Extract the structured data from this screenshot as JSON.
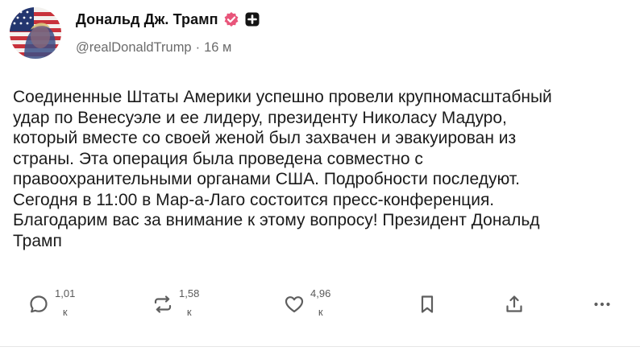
{
  "post": {
    "author": {
      "display_name": "Дональд Дж. Трамп",
      "handle": "@realDonaldTrump",
      "separator": "·",
      "time": "16 м",
      "avatar_icon": "avatar-flag-portrait",
      "verified_icon": "verified-badge-icon",
      "extra_badge_icon": "plus-badge-icon",
      "verified_color": "#e8557a"
    },
    "text_lines": [
      "Соединенные Штаты Америки успешно провели крупномасштабный",
      "удар по Венесуэле и ее лидеру, президенту Николасу Мадуро,",
      "который вместе со своей женой был захвачен и эвакуирован из",
      "страны. Эта операция была проведена совместно с",
      "правоохранительными органами США. Подробности последуют.",
      "Сегодня в 11:00 в Мар-а-Лаго состоится пресс-конференция.",
      "Благодарим вас за внимание к этому вопросу! Президент Дональд",
      "Трамп"
    ],
    "actions": {
      "reply": {
        "count": "1,01",
        "unit": "к",
        "icon": "reply-icon"
      },
      "repost": {
        "count": "1,58",
        "unit": "к",
        "icon": "repost-icon"
      },
      "like": {
        "count": "4,96",
        "unit": "к",
        "icon": "heart-icon"
      },
      "bookmark": {
        "icon": "bookmark-icon"
      },
      "share": {
        "icon": "share-icon"
      },
      "more": {
        "icon": "more-icon"
      }
    }
  }
}
